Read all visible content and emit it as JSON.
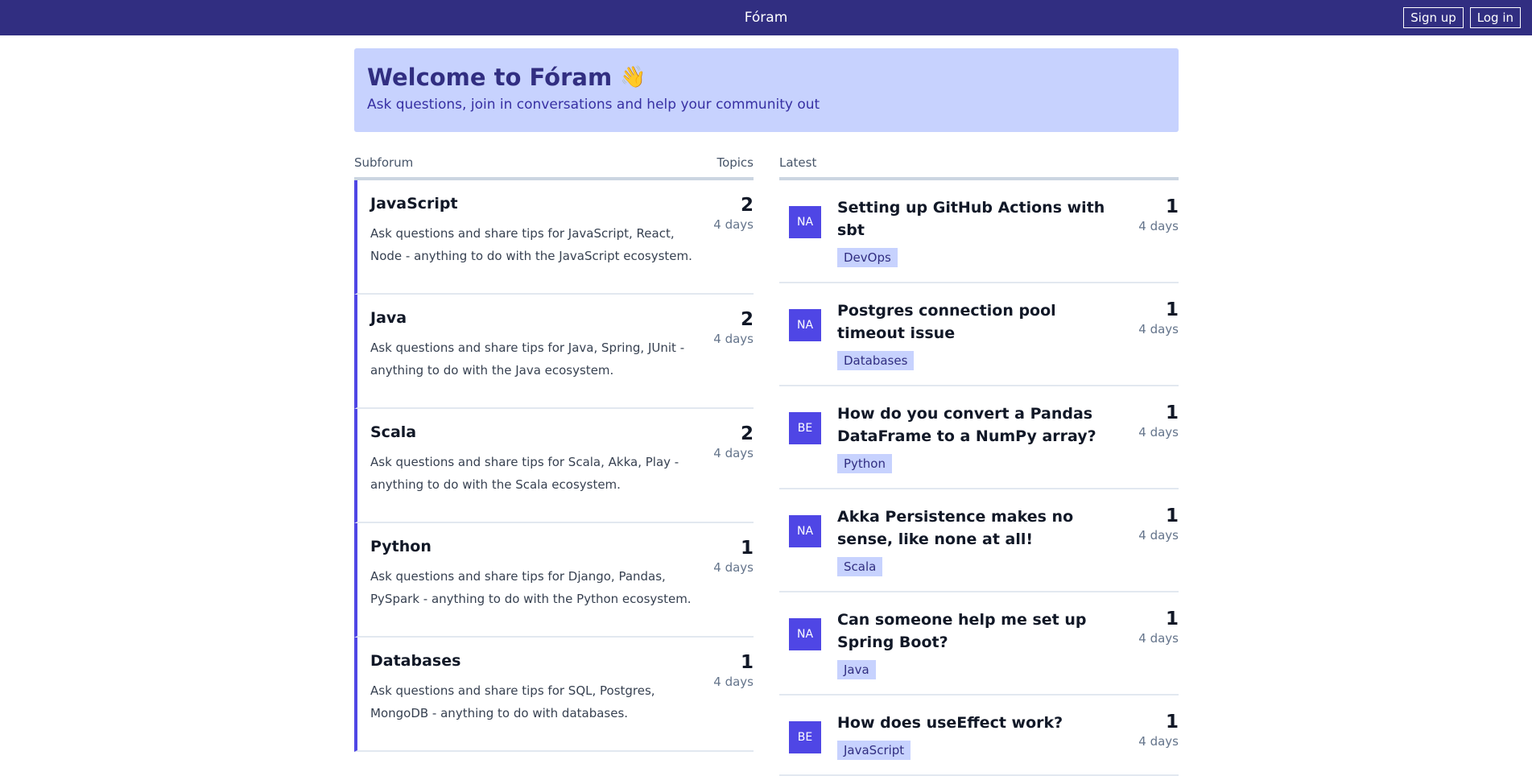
{
  "header": {
    "brand": "Fóram",
    "signup_label": "Sign up",
    "login_label": "Log in"
  },
  "hero": {
    "title": "Welcome to Fóram",
    "emoji": "👋",
    "subtitle": "Ask questions, join in conversations and help your community out"
  },
  "subforums": {
    "col_subforum": "Subforum",
    "col_topics": "Topics",
    "items": [
      {
        "name": "JavaScript",
        "desc": "Ask questions and share tips for JavaScript, React, Node - anything to do with the JavaScript ecosystem.",
        "count": "2",
        "ago": "4 days"
      },
      {
        "name": "Java",
        "desc": "Ask questions and share tips for Java, Spring, JUnit - anything to do with the Java ecosystem.",
        "count": "2",
        "ago": "4 days"
      },
      {
        "name": "Scala",
        "desc": "Ask questions and share tips for Scala, Akka, Play - anything to do with the Scala ecosystem.",
        "count": "2",
        "ago": "4 days"
      },
      {
        "name": "Python",
        "desc": "Ask questions and share tips for Django, Pandas, PySpark - anything to do with the Python ecosystem.",
        "count": "1",
        "ago": "4 days"
      },
      {
        "name": "Databases",
        "desc": "Ask questions and share tips for SQL, Postgres, MongoDB - anything to do with databases.",
        "count": "1",
        "ago": "4 days"
      }
    ]
  },
  "latest": {
    "col_latest": "Latest",
    "items": [
      {
        "avatar": "NA",
        "title": "Setting up GitHub Actions with sbt",
        "tag": "DevOps",
        "count": "1",
        "ago": "4 days"
      },
      {
        "avatar": "NA",
        "title": "Postgres connection pool timeout issue",
        "tag": "Databases",
        "count": "1",
        "ago": "4 days"
      },
      {
        "avatar": "BE",
        "title": "How do you convert a Pandas DataFrame to a NumPy array?",
        "tag": "Python",
        "count": "1",
        "ago": "4 days"
      },
      {
        "avatar": "NA",
        "title": "Akka Persistence makes no sense, like none at all!",
        "tag": "Scala",
        "count": "1",
        "ago": "4 days"
      },
      {
        "avatar": "NA",
        "title": "Can someone help me set up Spring Boot?",
        "tag": "Java",
        "count": "1",
        "ago": "4 days"
      },
      {
        "avatar": "BE",
        "title": "How does useEffect work?",
        "tag": "JavaScript",
        "count": "1",
        "ago": "4 days"
      }
    ]
  },
  "colors": {
    "topbar": "#312e81",
    "accent": "#4f46e5",
    "hero_bg": "#c7d2fe"
  }
}
